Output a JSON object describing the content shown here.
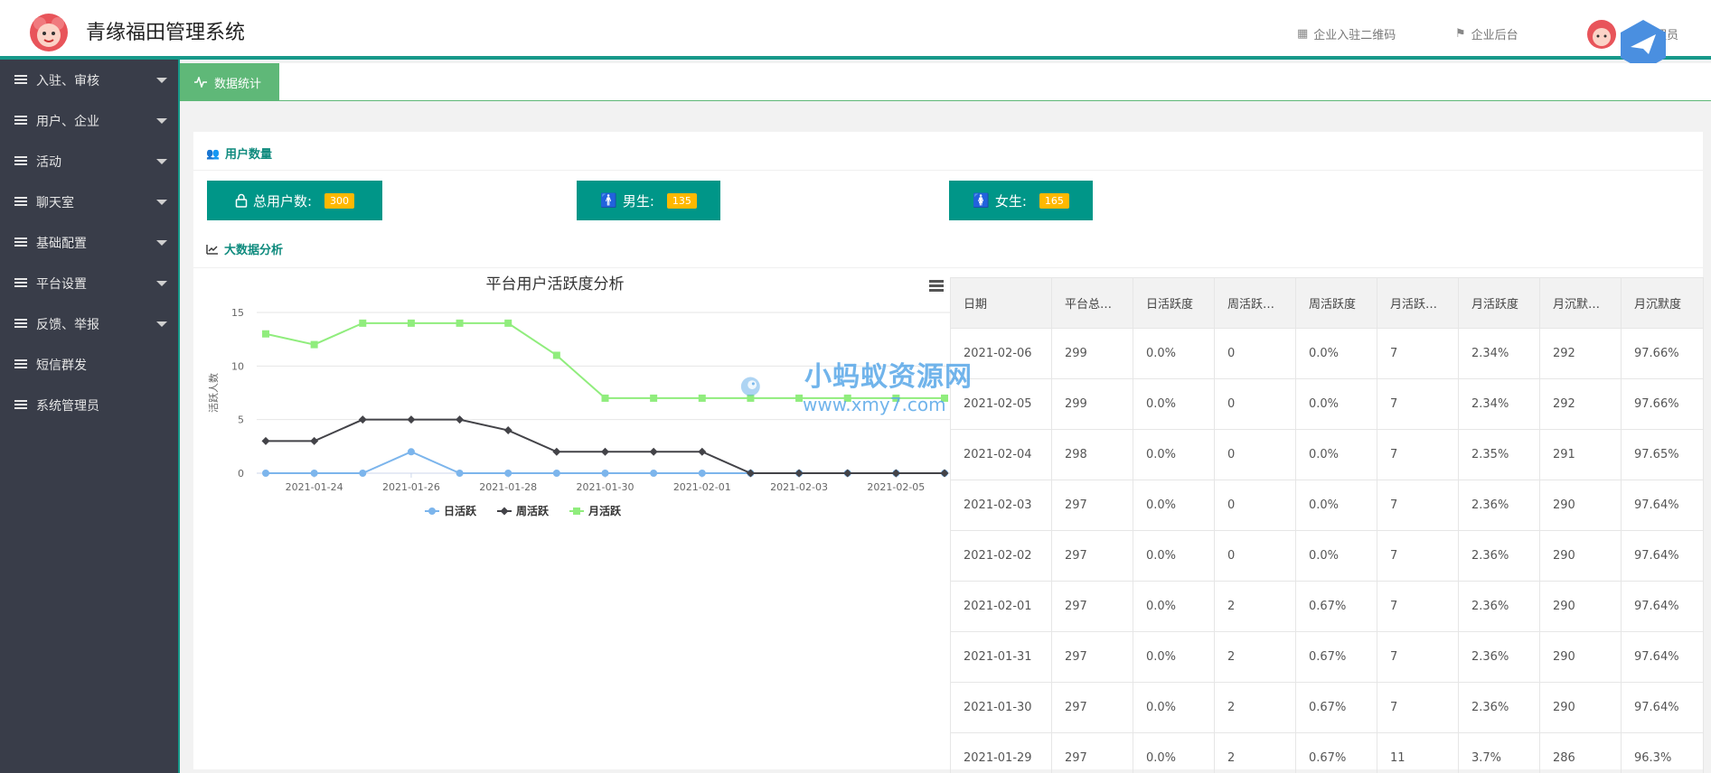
{
  "header": {
    "title": "青缘福田管理系统",
    "links": [
      {
        "label": "企业入驻二维码",
        "icon": "qrcode-icon"
      },
      {
        "label": "企业后台",
        "icon": "flag-icon"
      }
    ],
    "user": "管理员"
  },
  "sidebar": {
    "items": [
      {
        "label": "入驻、审核",
        "has_children": true
      },
      {
        "label": "用户、企业",
        "has_children": true
      },
      {
        "label": "活动",
        "has_children": true
      },
      {
        "label": "聊天室",
        "has_children": true
      },
      {
        "label": "基础配置",
        "has_children": true
      },
      {
        "label": "平台设置",
        "has_children": true
      },
      {
        "label": "反馈、举报",
        "has_children": true
      },
      {
        "label": "短信群发",
        "has_children": false
      },
      {
        "label": "系统管理员",
        "has_children": false
      }
    ]
  },
  "tabs": [
    {
      "label": "数据统计",
      "active": true
    }
  ],
  "user_section": {
    "title": "用户数量",
    "stats": [
      {
        "label": "总用户数:",
        "value": "300"
      },
      {
        "label": "男生:",
        "value": "135"
      },
      {
        "label": "女生:",
        "value": "165"
      }
    ]
  },
  "analysis_section": {
    "title": "大数据分析"
  },
  "chart_data": {
    "type": "line",
    "title": "平台用户活跃度分析",
    "ylabel": "活跃人数",
    "xlabel": "",
    "ylim": [
      0,
      15
    ],
    "yticks": [
      "0",
      "5",
      "10",
      "15"
    ],
    "x": [
      "2021-01-23",
      "2021-01-24",
      "2021-01-25",
      "2021-01-26",
      "2021-01-27",
      "2021-01-28",
      "2021-01-29",
      "2021-01-30",
      "2021-01-31",
      "2021-02-01",
      "2021-02-02",
      "2021-02-03",
      "2021-02-04",
      "2021-02-05",
      "2021-02-06"
    ],
    "xtick_labels": [
      "2021-01-24",
      "2021-01-26",
      "2021-01-28",
      "2021-01-30",
      "2021-02-01",
      "2021-02-03",
      "2021-02-05"
    ],
    "series": [
      {
        "name": "日活跃",
        "color": "#7cb5ec",
        "marker": "circle",
        "values": [
          0,
          0,
          0,
          2,
          0,
          0,
          0,
          0,
          0,
          0,
          0,
          0,
          0,
          0,
          0
        ]
      },
      {
        "name": "周活跃",
        "color": "#434348",
        "marker": "diamond",
        "values": [
          3,
          3,
          5,
          5,
          5,
          4,
          2,
          2,
          2,
          2,
          0,
          0,
          0,
          0,
          0
        ]
      },
      {
        "name": "月活跃",
        "color": "#90ed7d",
        "marker": "square",
        "values": [
          13,
          12,
          14,
          14,
          14,
          14,
          11,
          7,
          7,
          7,
          7,
          7,
          7,
          7,
          7
        ]
      }
    ],
    "legend": "bottom-center"
  },
  "table": {
    "headers": [
      "日期",
      "平台总用户数",
      "日活跃度",
      "周活跃人数",
      "周活跃度",
      "月活跃人数",
      "月活跃度",
      "月沉默人数",
      "月沉默度"
    ],
    "rows": [
      [
        "2021-02-06",
        "299",
        "0.0%",
        "0",
        "0.0%",
        "7",
        "2.34%",
        "292",
        "97.66%"
      ],
      [
        "2021-02-05",
        "299",
        "0.0%",
        "0",
        "0.0%",
        "7",
        "2.34%",
        "292",
        "97.66%"
      ],
      [
        "2021-02-04",
        "298",
        "0.0%",
        "0",
        "0.0%",
        "7",
        "2.35%",
        "291",
        "97.65%"
      ],
      [
        "2021-02-03",
        "297",
        "0.0%",
        "0",
        "0.0%",
        "7",
        "2.36%",
        "290",
        "97.64%"
      ],
      [
        "2021-02-02",
        "297",
        "0.0%",
        "0",
        "0.0%",
        "7",
        "2.36%",
        "290",
        "97.64%"
      ],
      [
        "2021-02-01",
        "297",
        "0.0%",
        "2",
        "0.67%",
        "7",
        "2.36%",
        "290",
        "97.64%"
      ],
      [
        "2021-01-31",
        "297",
        "0.0%",
        "2",
        "0.67%",
        "7",
        "2.36%",
        "290",
        "97.64%"
      ],
      [
        "2021-01-30",
        "297",
        "0.0%",
        "2",
        "0.67%",
        "7",
        "2.36%",
        "290",
        "97.64%"
      ],
      [
        "2021-01-29",
        "297",
        "0.0%",
        "2",
        "0.67%",
        "11",
        "3.7%",
        "286",
        "96.3%"
      ]
    ]
  },
  "watermark": {
    "title": "小蚂蚁资源网",
    "url": "www.xmy7.com"
  }
}
